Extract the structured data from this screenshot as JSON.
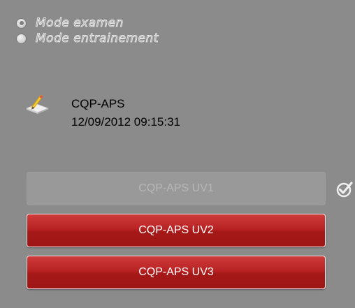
{
  "mode_options": [
    {
      "label": "Mode examen",
      "checked": true
    },
    {
      "label": "Mode entrainement",
      "checked": false
    }
  ],
  "session": {
    "icon": "pencil-icon",
    "name": "CQP-APS",
    "datetime": "12/09/2012 09:15:31"
  },
  "uv_buttons": [
    {
      "label": "CQP-APS UV1",
      "state": "disabled",
      "completed": true
    },
    {
      "label": "CQP-APS UV2",
      "state": "active"
    },
    {
      "label": "CQP-APS UV3",
      "state": "active"
    }
  ],
  "completed_icon": "check-circle-icon",
  "colors": {
    "background": "#8b8b8b",
    "button_red": "#b82222",
    "button_disabled": "#999999"
  }
}
